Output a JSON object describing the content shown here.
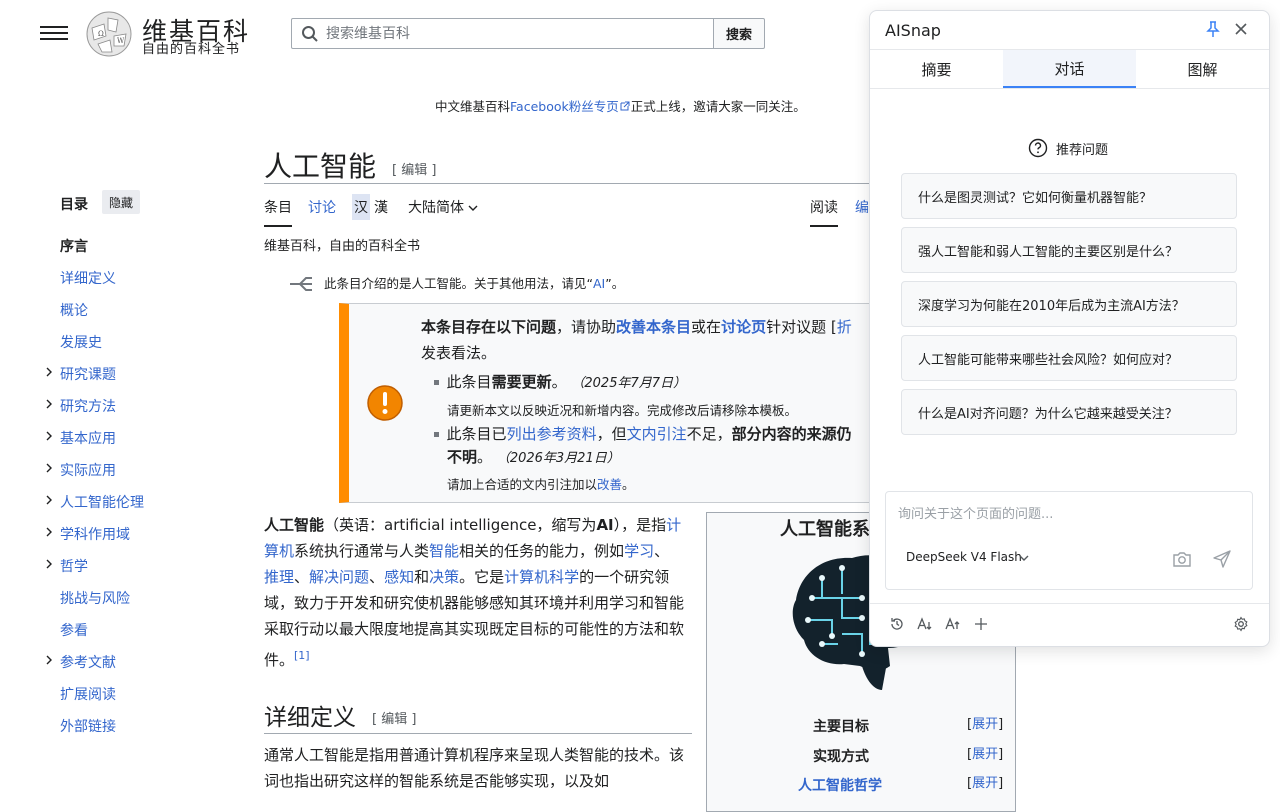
{
  "header": {
    "brand_title": "维基百科",
    "brand_tagline": "自由的百科全书",
    "search_placeholder": "搜索维基百科",
    "search_button": "搜索"
  },
  "notice": {
    "pre": "中文维基百科",
    "link": "Facebook粉丝专页",
    "post": "正式上线，邀请大家一同关注。"
  },
  "toc": {
    "heading": "目录",
    "hide": "隐藏",
    "items": [
      {
        "label": "序言",
        "expandable": false
      },
      {
        "label": "详细定义",
        "expandable": false
      },
      {
        "label": "概论",
        "expandable": false
      },
      {
        "label": "发展史",
        "expandable": false
      },
      {
        "label": "研究课题",
        "expandable": true
      },
      {
        "label": "研究方法",
        "expandable": true
      },
      {
        "label": "基本应用",
        "expandable": true
      },
      {
        "label": "实际应用",
        "expandable": true
      },
      {
        "label": "人工智能伦理",
        "expandable": true
      },
      {
        "label": "学科作用域",
        "expandable": true
      },
      {
        "label": "哲学",
        "expandable": true
      },
      {
        "label": "挑战与风险",
        "expandable": false
      },
      {
        "label": "参看",
        "expandable": false
      },
      {
        "label": "参考文献",
        "expandable": true
      },
      {
        "label": "扩展阅读",
        "expandable": false
      },
      {
        "label": "外部链接",
        "expandable": false
      }
    ]
  },
  "article": {
    "title": "人工智能",
    "title_edit": "[ 编辑 ]",
    "tabs": {
      "article": "条目",
      "talk": "讨论",
      "hans": "汉",
      "hant": "漢",
      "variant": "大陆简体",
      "read": "阅读",
      "edit": "编"
    },
    "site_sub": "维基百科，自由的百科全书",
    "hatnote": {
      "pre": "此条目介绍的是人工智能。关于其他用法，请见“",
      "link": "AI",
      "post": "”。"
    },
    "ambox": {
      "main_pre": "本条目存在以下问题",
      "main_mid1": "，请协助",
      "main_link1": "改善本条目",
      "main_mid2": "或在",
      "main_link2": "讨论页",
      "main_post": "针对议题",
      "main_bracket": "[",
      "main_cut": "折",
      "main_line2": "发表看法。",
      "item1_pre": "此条目",
      "item1_bold": "需要更新",
      "item1_post": "。",
      "item1_date": "（2025年7月7日）",
      "item1_sub": "请更新本文以反映近况和新增内容。完成修改后请移除本模板。",
      "item2_pre": "此条目已",
      "item2_link1": "列出参考资料",
      "item2_mid": "，但",
      "item2_link2": "文内引注",
      "item2_post": "不足，",
      "item2_bold": "部分内容的来源仍",
      "item2_line2": "不明",
      "item2_line2_post": "。",
      "item2_date": "（2026年3月21日）",
      "item2_sub_pre": "请加上合适的文内引注加以",
      "item2_sub_link": "改善",
      "item2_sub_post": "。"
    },
    "lead": {
      "bold": "人工智能",
      "t1": "（英语：artificial intelligence，缩写为",
      "ai": "AI",
      "t2": "），是指",
      "l1": "计算机",
      "t3": "系统执行通常与人类",
      "l2": "智能",
      "t4": "相关的任务的能力，例如",
      "l3": "学习",
      "s1": "、",
      "l4": "推理",
      "s2": "、",
      "l5": "解决问题",
      "s3": "、",
      "l6": "感知",
      "t5": "和",
      "l7": "决策",
      "t6": "。它是",
      "l8": "计算机科学",
      "t7": "的一个研究领域，致力于开发和研究使机器能够感知其环境并利用学习和智能采取行动以最大限度地提高其实现既定目标的可能性的方法和软件。",
      "ref": "[1]"
    },
    "section_title": "详细定义",
    "section_edit": "[ 编辑 ]",
    "para2": "通常人工智能是指用普通计算机程序来呈现人类智能的技术。该词也指出研究这样的智能系统是否能够实现，以及如"
  },
  "infobox": {
    "title": "人工智能系",
    "rows": [
      {
        "label": "主要目标",
        "expand": "展开",
        "link": false
      },
      {
        "label": "实现方式",
        "expand": "展开",
        "link": false
      },
      {
        "label": "人工智能哲学",
        "expand": "展开",
        "link": true
      }
    ]
  },
  "panel": {
    "title": "AISnap",
    "tabs": [
      "摘要",
      "对话",
      "图解"
    ],
    "active_tab": "对话",
    "recommended_label": "推荐问题",
    "questions": [
      "什么是图灵测试？它如何衡量机器智能？",
      "强人工智能和弱人工智能的主要区别是什么？",
      "深度学习为何能在2010年后成为主流AI方法？",
      "人工智能可能带来哪些社会风险？如何应对？",
      "什么是AI对齐问题？为什么它越来越受关注？"
    ],
    "input_placeholder": "询问关于这个页面的问题...",
    "model": "DeepSeek V4 Flash",
    "accent_color": "#3b82f6",
    "bottom_icons": [
      "history-icon",
      "font-decrease-icon",
      "font-increase-icon",
      "plus-icon",
      "settings-icon"
    ]
  }
}
